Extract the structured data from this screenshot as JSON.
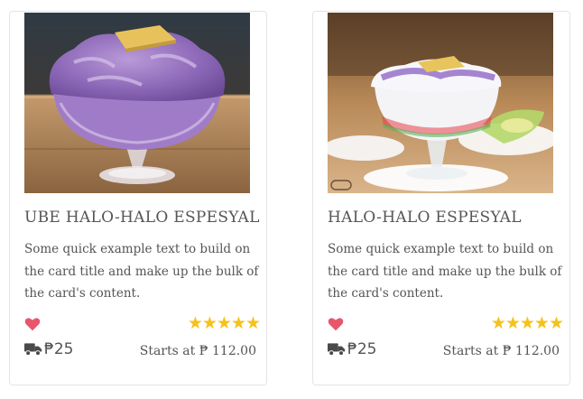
{
  "cards": [
    {
      "title": "UBE HALO-HALO ESPESYAL",
      "text": "Some quick example text to build on the card title and make up the bulk of the card's content.",
      "rating": 5,
      "stars": "★★★★★",
      "delivery_fee": "₱25",
      "price": "Starts at ₱ 112.00",
      "image": "purple ube halo-halo dessert in glass goblet"
    },
    {
      "title": "HALO-HALO ESPESYAL",
      "text": "Some quick example text to build on the card title and make up the bulk of the card's content.",
      "rating": 5,
      "stars": "★★★★★",
      "delivery_fee": "₱25",
      "price": "Starts at ₱ 112.00",
      "image": "halo-halo dessert in glass goblet on plate"
    }
  ],
  "colors": {
    "heart": "#e8566c",
    "star": "#f5c21b",
    "text": "#555555",
    "border": "#e4e4e4"
  },
  "icons": [
    "heart-icon",
    "truck-icon",
    "star-icon"
  ]
}
